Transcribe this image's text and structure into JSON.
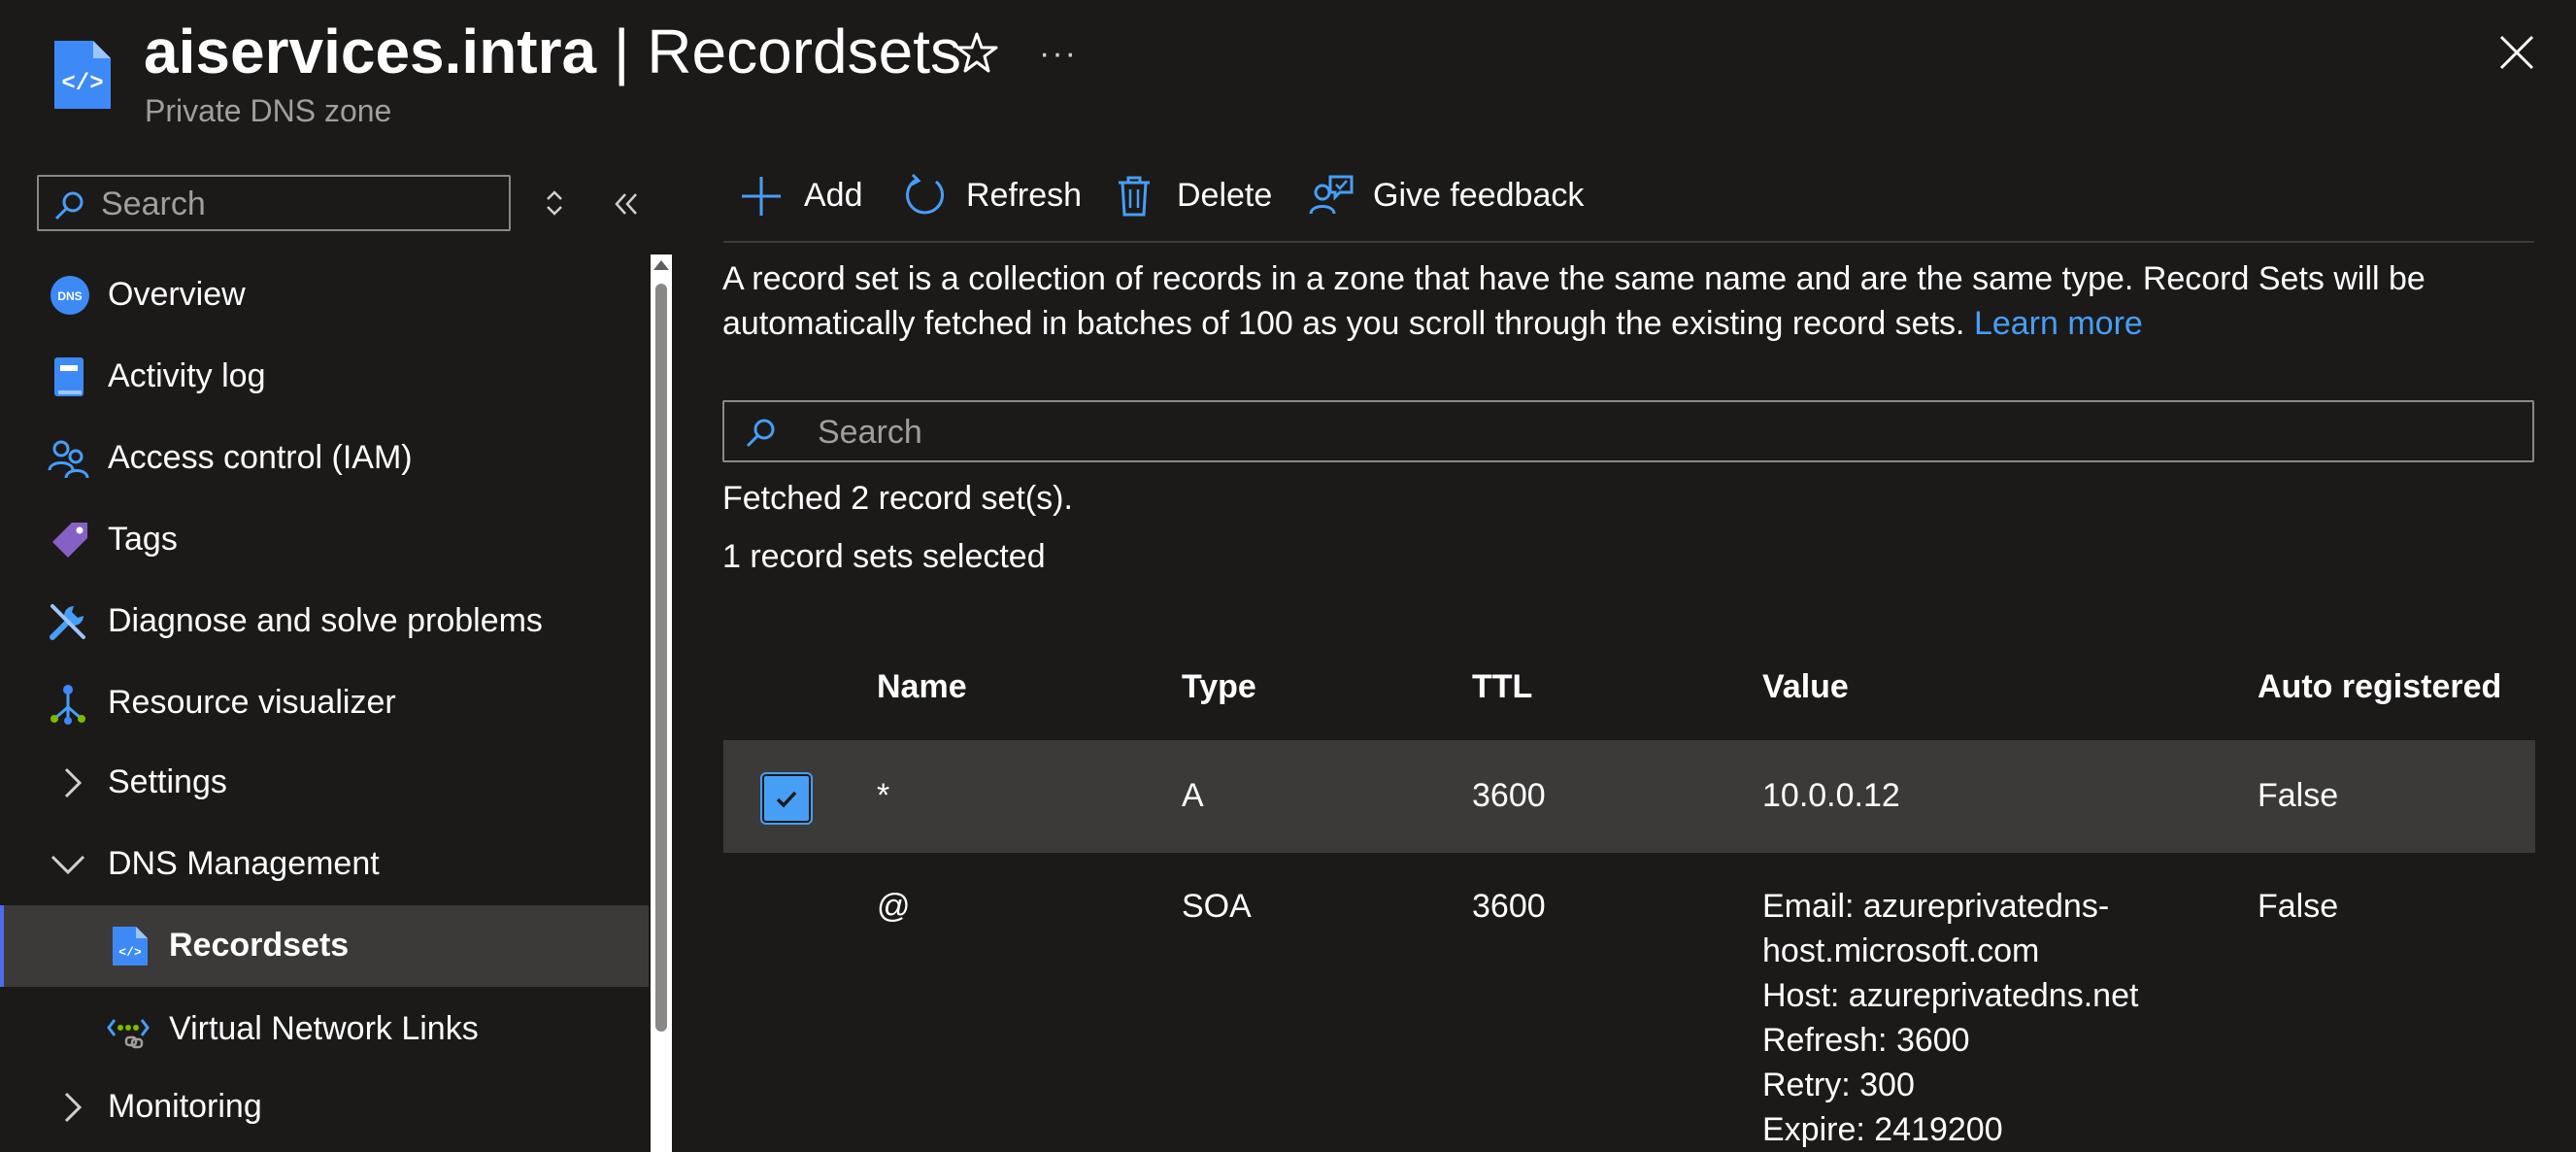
{
  "header": {
    "title_bold": "aiservices.intra",
    "title_rest": " | Recordsets",
    "subtitle": "Private DNS zone",
    "more": "···"
  },
  "sidebar": {
    "search_placeholder": "Search",
    "items": [
      {
        "label": "Overview",
        "icon": "dns-icon"
      },
      {
        "label": "Activity log",
        "icon": "activity-log-icon"
      },
      {
        "label": "Access control (IAM)",
        "icon": "people-icon"
      },
      {
        "label": "Tags",
        "icon": "tag-icon"
      },
      {
        "label": "Diagnose and solve problems",
        "icon": "wrench-icon"
      },
      {
        "label": "Resource visualizer",
        "icon": "hierarchy-icon"
      },
      {
        "label": "Settings",
        "icon": "chevron-right-icon"
      },
      {
        "label": "DNS Management",
        "icon": "chevron-down-icon"
      },
      {
        "label": "Recordsets",
        "icon": "recordset-file-icon"
      },
      {
        "label": "Virtual Network Links",
        "icon": "network-link-icon"
      },
      {
        "label": "Monitoring",
        "icon": "chevron-right-icon"
      }
    ]
  },
  "toolbar": {
    "add": "Add",
    "refresh": "Refresh",
    "delete": "Delete",
    "feedback": "Give feedback"
  },
  "main": {
    "description": "A record set is a collection of records in a zone that have the same name and are the same type. Record Sets will be automatically fetched in batches of 100 as you scroll through the existing record sets.",
    "learn_more": "Learn more",
    "search_placeholder": "Search",
    "fetched_text": "Fetched 2 record set(s).",
    "selected_text": "1 record sets selected"
  },
  "table": {
    "columns": [
      "Name",
      "Type",
      "TTL",
      "Value",
      "Auto registered"
    ],
    "rows": [
      {
        "name": "*",
        "type": "A",
        "ttl": "3600",
        "value": [
          "10.0.0.12"
        ],
        "auto": "False",
        "selected": true
      },
      {
        "name": "@",
        "type": "SOA",
        "ttl": "3600",
        "value": [
          "Email: azureprivatedns-",
          "host.microsoft.com",
          "Host: azureprivatedns.net",
          "Refresh: 3600",
          "Retry: 300",
          "Expire: 2419200"
        ],
        "auto": "False",
        "selected": false
      }
    ]
  },
  "colors": {
    "background": "#1b1a19",
    "accent": "#479ef5",
    "selected_row": "#3b3a39",
    "muted_text": "#a19f9d"
  }
}
